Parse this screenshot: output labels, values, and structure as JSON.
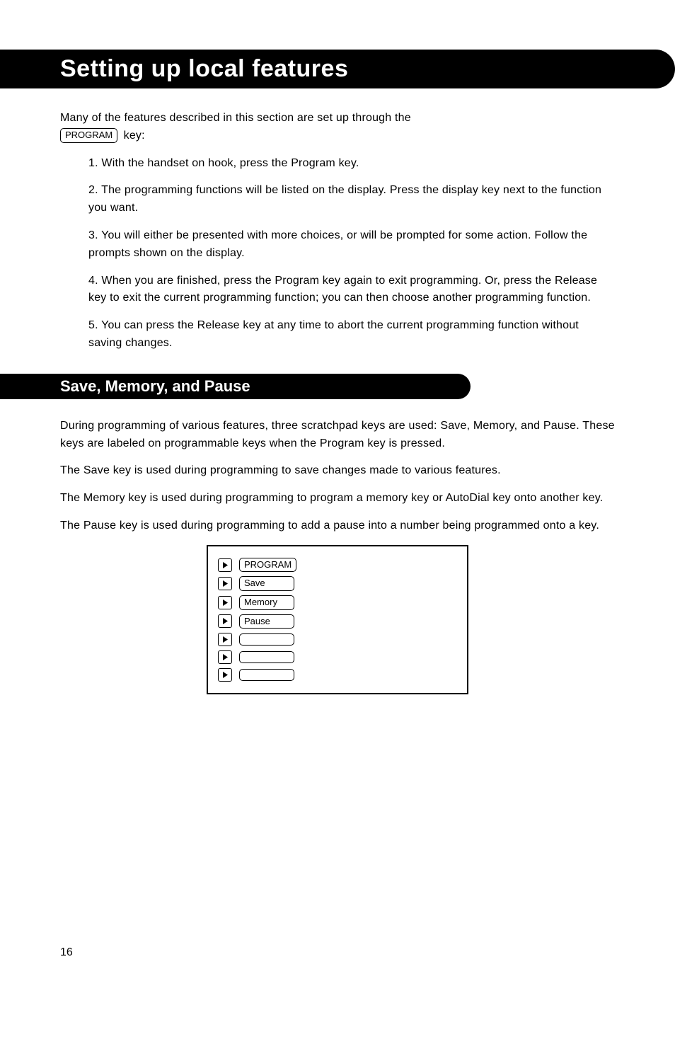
{
  "title": "Setting up local features",
  "intro_para_a": "Many of the features described in this section are set up through the",
  "intro_key": "PROGRAM",
  "intro_para_b": "key:",
  "program_steps": [
    "1. With the handset on hook, press the Program key.",
    "2. The programming functions will be listed on the display. Press the display key next to the function you want.",
    "3. You will either be presented with more choices, or will be prompted for some action. Follow the prompts shown on the display.",
    "4. When you are finished, press the Program key again to exit programming. Or, press the Release key to exit the current programming function; you can then choose another programming function.",
    "5. You can press the Release key at any time to abort the current programming function without saving changes."
  ],
  "subtitle": "Save, Memory, and Pause",
  "smp_para1": "During programming of various features, three scratchpad keys are used: Save, Memory, and Pause. These keys are labeled on programmable keys when the Program key is pressed.",
  "smp_para2": "The Save key is used during programming to save changes made to various features.",
  "smp_para3": "The Memory key is used during programming to program a memory key or AutoDial key onto another key.",
  "smp_para4": "The Pause key is used during programming to add a pause into a number being programmed onto a key.",
  "panel": {
    "rows": [
      {
        "label": "PROGRAM"
      },
      {
        "label": "Save"
      },
      {
        "label": "Memory"
      },
      {
        "label": "Pause"
      },
      {
        "label": ""
      },
      {
        "label": ""
      },
      {
        "label": ""
      }
    ]
  },
  "pagenum": "16"
}
